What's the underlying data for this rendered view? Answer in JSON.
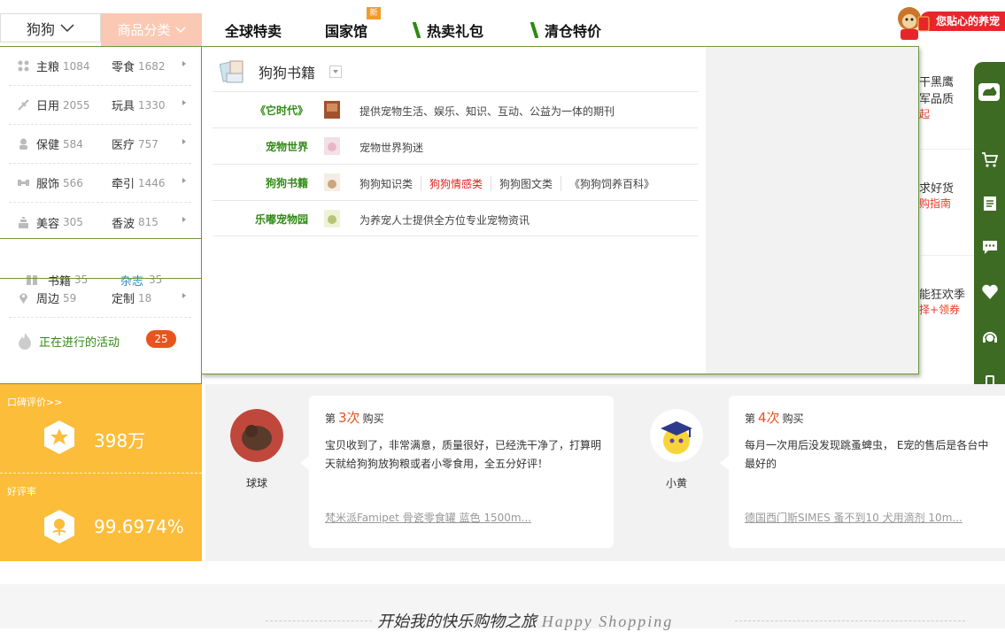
{
  "nav": {
    "pet_select": "狗狗",
    "category_btn": "商品分类",
    "links": [
      "全球特卖",
      "国家馆",
      "热卖礼包",
      "清仓特价"
    ],
    "new_badge": "新",
    "promo_text": "您贴心的养宠"
  },
  "categories": [
    {
      "a": {
        "name": "主粮",
        "count": "1084"
      },
      "b": {
        "name": "零食",
        "count": "1682"
      }
    },
    {
      "a": {
        "name": "日用",
        "count": "2055"
      },
      "b": {
        "name": "玩具",
        "count": "1330"
      }
    },
    {
      "a": {
        "name": "保健",
        "count": "584"
      },
      "b": {
        "name": "医疗",
        "count": "757"
      }
    },
    {
      "a": {
        "name": "服饰",
        "count": "566"
      },
      "b": {
        "name": "牵引",
        "count": "1446"
      }
    },
    {
      "a": {
        "name": "美容",
        "count": "305"
      },
      "b": {
        "name": "香波",
        "count": "815"
      }
    }
  ],
  "books_row": {
    "a": {
      "name": "书籍",
      "count": "35"
    },
    "b": {
      "name": "杂志",
      "count": "35"
    }
  },
  "misc_row": {
    "a": {
      "name": "周边",
      "count": "59"
    },
    "b": {
      "name": "定制",
      "count": "18"
    }
  },
  "activity": {
    "label": "正在进行的活动",
    "count": "25"
  },
  "dropdown": {
    "title": "狗狗书籍",
    "rows": [
      {
        "label": "《它时代》",
        "items": [
          "提供宠物生活、娱乐、知识、互动、公益为一体的期刊"
        ]
      },
      {
        "label": "宠物世界",
        "items": [
          "宠物世界狗迷"
        ]
      },
      {
        "label": "狗狗书籍",
        "items": [
          "狗狗知识类",
          "狗狗情感类",
          "狗狗图文类",
          "《狗狗饲养百科》"
        ]
      },
      {
        "label": "乐嘟宠物园",
        "items": [
          "为养宠人士提供全方位专业宠物资讯"
        ]
      }
    ]
  },
  "bg_items": [
    {
      "line1": "干黑鹰",
      "line2": "军品质",
      "line3": "起"
    },
    {
      "line1": "求好货",
      "line2": "购指南"
    },
    {
      "line1": "能狂欢季",
      "line2": "择+领券"
    }
  ],
  "stats": {
    "rating_label": "口碑评价>>",
    "rating_value": "398万",
    "good_label": "好评率",
    "good_value": "99.6974%"
  },
  "reviews": [
    {
      "user": "球球",
      "prefix": "第",
      "times": "3次",
      "suffix": "购买",
      "text": "宝贝收到了，非常满意，质量很好，已经洗干净了，打算明天就给狗狗放狗粮或者小零食用，全五分好评！",
      "product": "梵米派Famipet 骨瓷零食罐 蓝色 1500m..."
    },
    {
      "user": "小黄",
      "prefix": "第",
      "times": "4次",
      "suffix": "购买",
      "text": "每月一次用后没发现跳蚤蜱虫， E宠的售后是各台中最好的",
      "product": "德国西门斯SIMES 蚤不到10 犬用滴剂 10m..."
    }
  ],
  "bottom": {
    "slogan_cn": "开始我的快乐购物之旅",
    "slogan_en": "Happy Shopping"
  },
  "colors": {
    "green": "#3d6b23",
    "orange": "#fcbd3a",
    "accent": "#e8541e",
    "pink": "#fbc9b3"
  }
}
